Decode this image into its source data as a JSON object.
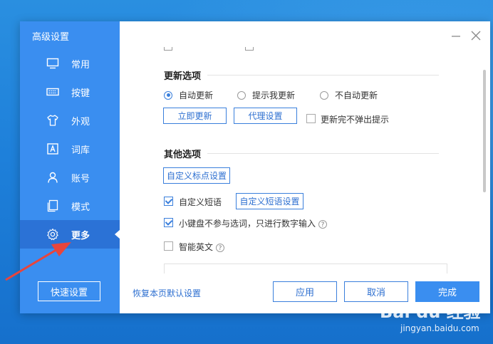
{
  "sidebar": {
    "title": "高级设置",
    "items": [
      {
        "label": "常用",
        "icon": "monitor-icon"
      },
      {
        "label": "按键",
        "icon": "keyboard-icon"
      },
      {
        "label": "外观",
        "icon": "shirt-icon"
      },
      {
        "label": "词库",
        "icon": "dictionary-icon"
      },
      {
        "label": "账号",
        "icon": "user-icon"
      },
      {
        "label": "模式",
        "icon": "mode-icon"
      },
      {
        "label": "更多",
        "icon": "gear-icon",
        "active": true
      }
    ],
    "quick_settings": "快速设置"
  },
  "update_section": {
    "title": "更新选项",
    "options": [
      "自动更新",
      "提示我更新",
      "不自动更新"
    ],
    "selected": "自动更新",
    "update_now": "立即更新",
    "proxy_settings": "代理设置",
    "no_popup_label": "更新完不弹出提示",
    "no_popup_checked": false
  },
  "other_section": {
    "title": "其他选项",
    "custom_punct": "自定义标点设置",
    "custom_phrase_label": "自定义短语",
    "custom_phrase_checked": true,
    "custom_phrase_settings": "自定义短语设置",
    "keypad_label": "小键盘不参与选词，只进行数字输入",
    "keypad_checked": true,
    "smart_english_label": "智能英文",
    "smart_english_checked": false
  },
  "footer": {
    "restore": "恢复本页默认设置",
    "apply": "应用",
    "cancel": "取消",
    "done": "完成"
  },
  "watermark": {
    "brand": "Bai du 经验",
    "url": "jingyan.baidu.com"
  },
  "colors": {
    "sidebar": "#3a8ef0",
    "sidebar_active": "#2b72d6",
    "accent": "#3a7fdc",
    "arrow": "#e8453c"
  },
  "help_glyph": "?"
}
